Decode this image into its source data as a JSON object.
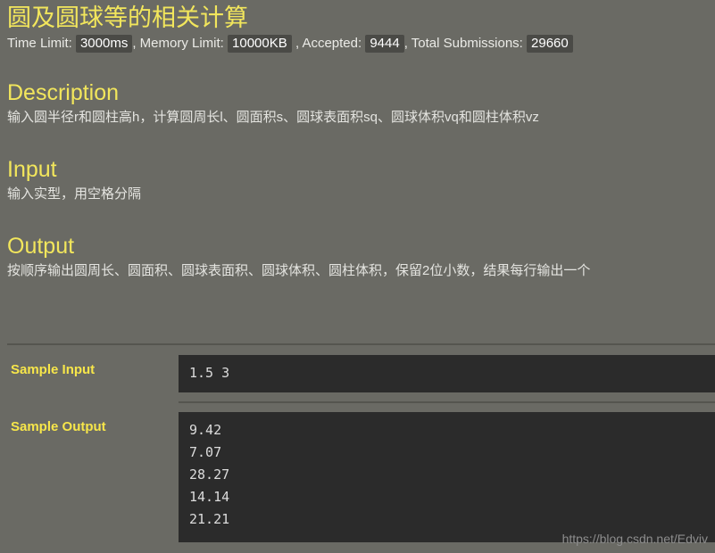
{
  "header": {
    "title": "圆及圆球等的相关计算",
    "meta": {
      "time_limit_label": "Time Limit:",
      "time_limit_value": "3000ms",
      "comma1": ",",
      "memory_limit_label": "Memory Limit:",
      "memory_limit_value": "10000KB",
      "comma2": ",",
      "accepted_label": "Accepted:",
      "accepted_value": "9444",
      "comma3": ",",
      "submissions_label": "Total Submissions:",
      "submissions_value": "29660"
    }
  },
  "sections": {
    "description": {
      "heading": "Description",
      "body": "输入圆半径r和圆柱高h，计算圆周长l、圆面积s、圆球表面积sq、圆球体积vq和圆柱体积vz"
    },
    "input": {
      "heading": "Input",
      "body": "输入实型，用空格分隔"
    },
    "output": {
      "heading": "Output",
      "body": "按顺序输出圆周长、圆面积、圆球表面积、圆球体积、圆柱体积，保留2位小数，结果每行输出一个"
    }
  },
  "samples": {
    "input": {
      "label": "Sample Input",
      "lines": [
        "1.5 3"
      ]
    },
    "output": {
      "label": "Sample Output",
      "lines": [
        "9.42",
        "7.07",
        "28.27",
        "14.14",
        "21.21"
      ]
    }
  },
  "watermark": "https://blog.csdn.net/Edviv",
  "colors": {
    "page_background": "#6a6a64",
    "accent_yellow": "#f2e65c",
    "sample_label_yellow": "#f7e64a",
    "code_background": "#2b2b2b",
    "badge_background": "#4a4a46",
    "body_text": "#e4e4e0",
    "divider": "#55554f"
  }
}
